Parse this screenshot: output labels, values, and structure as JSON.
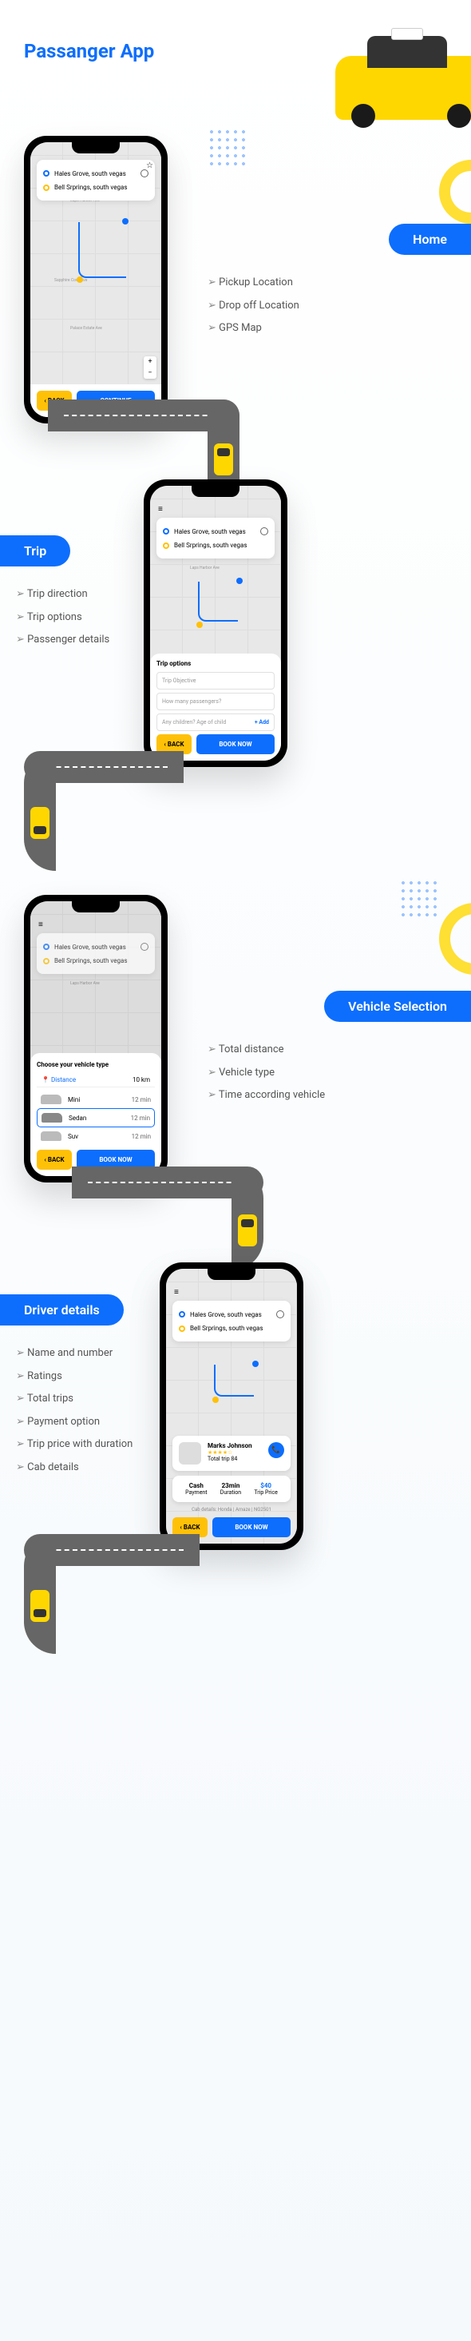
{
  "title": "Passanger App",
  "addresses": {
    "pickup": "Hales Grove, south vegas",
    "drop": "Bell Srprings, south vegas"
  },
  "buttons": {
    "back": "‹ BACK",
    "continue": "CONTINUE",
    "bookNow": "BOOK NOW"
  },
  "sections": {
    "home": {
      "label": "Home",
      "items": [
        "Pickup Location",
        "Drop off Location",
        "GPS Map"
      ]
    },
    "trip": {
      "label": "Trip",
      "items": [
        "Trip direction",
        "Trip options",
        "Passenger details"
      ]
    },
    "vehicle": {
      "label": "Vehicle Selection",
      "items": [
        "Total distance",
        "Vehicle type",
        "Time according vehicle"
      ]
    },
    "driver": {
      "label": "Driver details",
      "items": [
        "Name and number",
        "Ratings",
        "Total trips",
        "Payment option",
        "Trip price with duration",
        "Cab details"
      ]
    }
  },
  "tripOptions": {
    "title": "Trip options",
    "objective": "Trip Objective",
    "passengers": "How many passengers?",
    "children": "Any children? Age of child",
    "add": "+ Add"
  },
  "vehicleSel": {
    "title": "Choose your vehicle type",
    "distLabel": "Distance",
    "distVal": "10 km",
    "vehicles": [
      {
        "name": "Mini",
        "time": "12 min"
      },
      {
        "name": "Sedan",
        "time": "12 min"
      },
      {
        "name": "Suv",
        "time": "12 min"
      }
    ]
  },
  "driverDet": {
    "name": "Marks Johnson",
    "rating": "★★★★☆",
    "trips": "Total trip 84",
    "stats": [
      {
        "val": "Cash",
        "label": "Payment"
      },
      {
        "val": "23min",
        "label": "Duration"
      },
      {
        "val": "$40",
        "label": "Trip Price"
      }
    ],
    "cab": "Cab details: Honda  |  Amaze  |  NG2501"
  },
  "streets": {
    "laps": "Laps Harbor Ave",
    "sapphire": "Sapphire Cove Ave",
    "palace": "Palace Estate Ave"
  },
  "zoom": {
    "plus": "+",
    "minus": "−"
  }
}
